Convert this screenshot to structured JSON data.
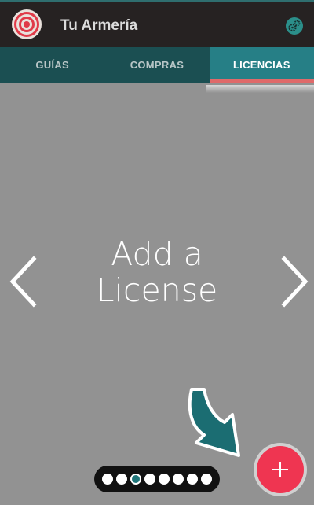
{
  "header": {
    "title": "Tu Armería",
    "logo_icon": "target-icon",
    "settings_icon": "gear-icon"
  },
  "tabs": [
    {
      "label": "GUÍAS",
      "active": false
    },
    {
      "label": "COMPRAS",
      "active": false
    },
    {
      "label": "LICENCIAS",
      "active": true
    }
  ],
  "main": {
    "headline_line1": "Add a",
    "headline_line2": "License",
    "prev_icon": "chevron-left-icon",
    "next_icon": "chevron-right-icon",
    "pointer_icon": "curved-arrow-icon"
  },
  "pager": {
    "count": 8,
    "active_index": 2
  },
  "fab": {
    "icon": "plus-icon",
    "color": "#ef3551"
  },
  "colors": {
    "appbar": "#262222",
    "tab_bar": "#1b4f52",
    "tab_active": "#267f86",
    "tab_indicator": "#e06a6a",
    "background": "#929292",
    "accent": "#20767a"
  }
}
